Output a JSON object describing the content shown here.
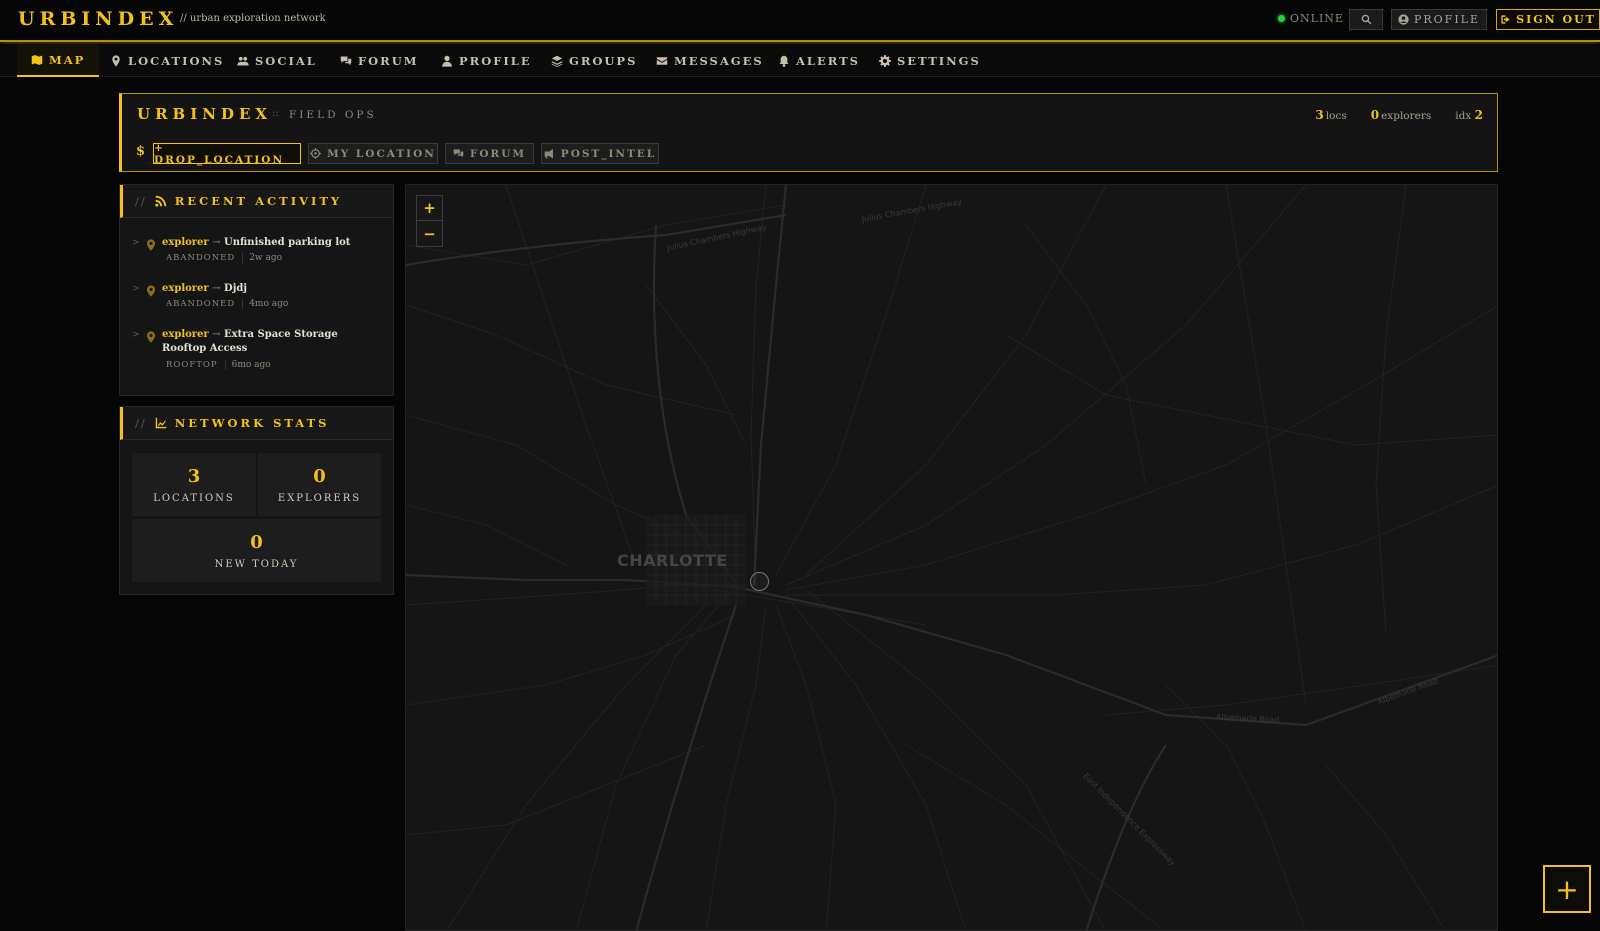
{
  "brand": {
    "name": "URBINDEX",
    "tagline": "// urban exploration network"
  },
  "topbar": {
    "status": "ONLINE",
    "profile": "PROFILE",
    "signout": "SIGN OUT"
  },
  "nav": [
    {
      "label": "MAP",
      "icon": "map-icon"
    },
    {
      "label": "LOCATIONS",
      "icon": "pin-icon"
    },
    {
      "label": "SOCIAL",
      "icon": "users-icon"
    },
    {
      "label": "FORUM",
      "icon": "comments-icon"
    },
    {
      "label": "PROFILE",
      "icon": "user-icon"
    },
    {
      "label": "GROUPS",
      "icon": "layers-icon"
    },
    {
      "label": "MESSAGES",
      "icon": "envelope-icon"
    },
    {
      "label": "ALERTS",
      "icon": "bell-icon"
    },
    {
      "label": "SETTINGS",
      "icon": "gear-icon"
    }
  ],
  "header": {
    "title": "URBINDEX",
    "separator": "::",
    "subtitle": "FIELD OPS",
    "stats": [
      {
        "value": "3",
        "label": "locs"
      },
      {
        "value": "0",
        "label": "explorers"
      },
      {
        "prefix": "idx",
        "value": "2"
      }
    ],
    "prompt": "$",
    "actions": {
      "drop": "+ DROP_LOCATION",
      "mylocation": "MY LOCATION",
      "forum": "FORUM",
      "intel": "POST_INTEL"
    }
  },
  "activity": {
    "title": "RECENT ACTIVITY",
    "slashes": "//",
    "items": [
      {
        "who": "explorer",
        "arrow": "→",
        "place": "Unfinished parking lot",
        "tag": "ABANDONED",
        "time": "2w ago"
      },
      {
        "who": "explorer",
        "arrow": "→",
        "place": "Djdj",
        "tag": "ABANDONED",
        "time": "4mo ago"
      },
      {
        "who": "explorer",
        "arrow": "→",
        "place": "Extra Space Storage Rooftop Access",
        "tag": "ROOFTOP",
        "time": "6mo ago"
      }
    ]
  },
  "stats": {
    "title": "NETWORK STATS",
    "slashes": "//",
    "locations": {
      "value": "3",
      "label": "LOCATIONS"
    },
    "explorers": {
      "value": "0",
      "label": "EXPLORERS"
    },
    "today": {
      "value": "0",
      "label": "NEW TODAY"
    }
  },
  "map": {
    "zoom_in": "+",
    "zoom_out": "−",
    "city": "CHARLOTTE",
    "streets": {
      "julius1": "Julius Chambers Highway",
      "julius2": "Julius Chambers Highway",
      "albemarle1": "Albemarle Road",
      "albemarle2": "Albemarle Road",
      "independence": "East Independence Expressway"
    }
  },
  "fab": "+",
  "colors": {
    "accent": "#f2c21b",
    "background": "#050505",
    "panel": "#151515",
    "online": "#2ecc40"
  }
}
